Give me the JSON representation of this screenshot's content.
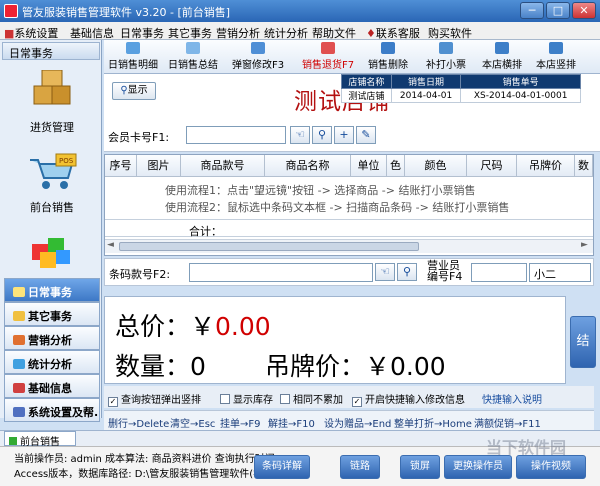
{
  "title_bar": {
    "title": "管友服装销售管理软件 v3.20 - [前台销售]",
    "min_label": "─",
    "max_label": "□",
    "close_label": "✕"
  },
  "menu": [
    "系统设置",
    "基础信息",
    "日常事务",
    "其它事务",
    "营销分析",
    "统计分析",
    "帮助文件",
    "联系客服",
    "购买软件"
  ],
  "sidebar": {
    "header": "日常事务",
    "tiles": [
      {
        "label": "进货管理"
      },
      {
        "label": "前台销售"
      }
    ],
    "tabs": [
      {
        "label": "日常事务",
        "active": true
      },
      {
        "label": "其它事务"
      },
      {
        "label": "营销分析"
      },
      {
        "label": "统计分析"
      },
      {
        "label": "基础信息"
      },
      {
        "label": "系统设置及帮..."
      }
    ]
  },
  "toolbar": [
    "日销售明细",
    "日销售总结",
    "弹窗修改F3",
    "销售退货F7",
    "销售删除",
    "补打小票",
    "本店横排",
    "本店竖排"
  ],
  "info": {
    "show_button": "显示",
    "store_title": "测试店铺",
    "order_table": {
      "headers": [
        "店铺名称",
        "销售日期",
        "销售单号"
      ],
      "row": [
        "测试店铺",
        "2014-04-01",
        "XS-2014-04-01-0001"
      ]
    },
    "member_label": "会员卡号F1:",
    "member_value": ""
  },
  "grid": {
    "headers": [
      "序号",
      "图片",
      "商品款号",
      "商品名称",
      "单位",
      "色",
      "颜色",
      "尺码",
      "吊牌价",
      "数"
    ],
    "hint1": "使用流程1：点击\"望远镜\"按钮 -> 选择商品 -> 结账打小票销售",
    "hint2": "使用流程2：鼠标选中条码文本框 -> 扫描商品条码 -> 结账打小票销售",
    "sum_label": "合计："
  },
  "barcode": {
    "label": "条码款号F2:",
    "value": "",
    "salesperson_label_1": "营业员",
    "salesperson_label_2": "编号F4",
    "salesperson_code": "",
    "salesperson_name": "小二"
  },
  "totals": {
    "total_label": "总价：￥",
    "total_value": "0.00",
    "qty_label": "数量：",
    "qty_value": "0",
    "tag_label": "吊牌价：￥",
    "tag_value": "0.00",
    "side_button": "结"
  },
  "checks": [
    {
      "label": "查询按钮弹出竖排",
      "checked": true
    },
    {
      "label": "显示库存",
      "checked": false
    },
    {
      "label": "相同不累加",
      "checked": false
    },
    {
      "label": "开启快捷输入修改信息",
      "checked": true
    }
  ],
  "quick_input_link": "快捷输入说明",
  "shortcuts": [
    "删行→Delete",
    "清空→Esc",
    "挂单→F9",
    "解挂→F10",
    "设为赠品→End",
    "整单打折→Home",
    "满额促销→F11"
  ],
  "bottom_tab": "前台销售",
  "status": {
    "line1": "当前操作员: admin   成本算法: 商品资料进价   查询执行时间:",
    "line2": "Access版本，数据库路径: D:\\管友服装销售管理软件(零"
  },
  "footer_buttons": [
    "条码详解",
    "链路",
    "锁屏",
    "更换操作员",
    "操作视频"
  ],
  "watermark": "当下软件园",
  "colors": {
    "accent_red": "#d00000",
    "title_blue": "#2a66b5",
    "store_title": "#b31010"
  }
}
